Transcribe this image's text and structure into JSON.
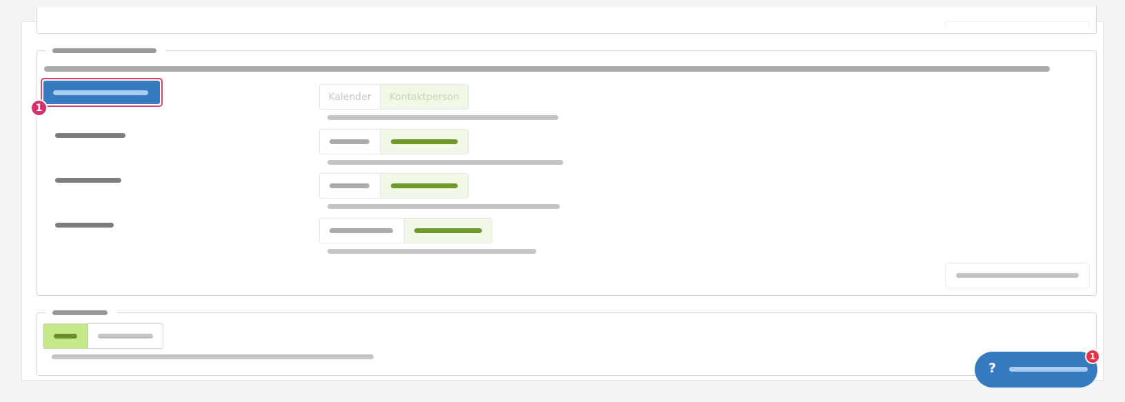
{
  "step_badge": "1",
  "segmented_faded": {
    "options": [
      "Kalender",
      "Kontaktperson"
    ],
    "selected": "Kontaktperson"
  },
  "help": {
    "icon": "?",
    "badge": "1"
  },
  "colors": {
    "primary": "#367bc0",
    "highlight_border": "#d9426a",
    "badge": "#d6336c",
    "active_segment": "#f2f8e8",
    "toggle_on": "#c6e98a",
    "help_badge": "#e8334a"
  }
}
